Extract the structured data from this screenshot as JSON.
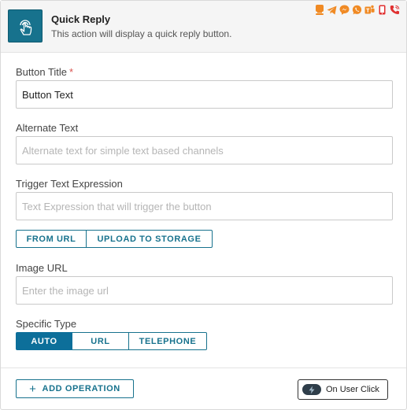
{
  "header": {
    "title": "Quick Reply",
    "subtitle": "This action will display a quick reply button.",
    "icon": "touch-hand-icon",
    "channel_icons": [
      "web-chat-icon",
      "telegram-icon",
      "messenger-icon",
      "whatsapp-icon",
      "teams-icon",
      "mobile-icon",
      "phone-icon"
    ]
  },
  "fields": {
    "button_title": {
      "label": "Button Title",
      "required_mark": "*",
      "value": "Button Text",
      "placeholder": ""
    },
    "alternate_text": {
      "label": "Alternate Text",
      "value": "",
      "placeholder": "Alternate text for simple text based channels"
    },
    "trigger_text": {
      "label": "Trigger Text Expression",
      "value": "",
      "placeholder": "Text Expression that will trigger the button"
    },
    "image_url": {
      "label": "Image URL",
      "value": "",
      "placeholder": "Enter the image url"
    },
    "specific_type": {
      "label": "Specific Type"
    }
  },
  "image_source": {
    "from_url": "FROM URL",
    "upload": "UPLOAD TO STORAGE"
  },
  "type_options": {
    "auto": "AUTO",
    "url": "URL",
    "telephone": "TELEPHONE",
    "selected": "AUTO"
  },
  "footer": {
    "add_operation": "ADD OPERATION",
    "trigger": "On User Click"
  },
  "colors": {
    "accent": "#17728d",
    "active": "#0d6f9a",
    "required": "#d9534f",
    "channel": "#f08a24"
  }
}
